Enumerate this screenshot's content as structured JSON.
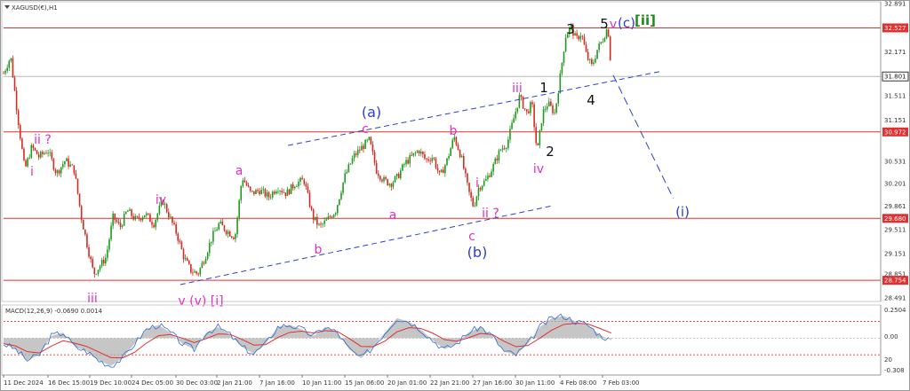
{
  "header": {
    "title": "XAGUSD(€),H1",
    "macd_title": "MACD(12,26,9) -0.0690 0.0014"
  },
  "colors": {
    "up": "#1f9a1f",
    "down": "#d42a1f",
    "hline": "#e03030",
    "channel": "#2b3fd0",
    "magenta": "#e030c0",
    "black": "#111111",
    "green": "#1f8a1f",
    "macd_line": "#2a6ad8",
    "signal": "#e03030",
    "hist": "#b3b3b3",
    "grid_text": "#333333"
  },
  "price_axis": {
    "ticks": [
      "32.891",
      "32.527",
      "32.171",
      "31.801",
      "31.511",
      "31.151",
      "30.972",
      "30.531",
      "30.201",
      "29.861",
      "29.680",
      "29.511",
      "29.151",
      "28.851",
      "28.754",
      "28.491"
    ]
  },
  "macd_axis": {
    "ticks": [
      "0.2504",
      "0.00",
      "20",
      "-0.308"
    ]
  },
  "time_axis": {
    "ticks": [
      "11 Dec 2024",
      "16 Dec 15:00",
      "19 Dec 10:00",
      "24 Dec 05:00",
      "30 Dec 03:00",
      "2 Jan 21:00",
      "7 Jan 16:00",
      "10 Jan 11:00",
      "15 Jan 06:00",
      "20 Jan 01:00",
      "22 Jan 21:00",
      "27 Jan 16:00",
      "30 Jan 11:00",
      "4 Feb 08:00",
      "7 Feb 03:00"
    ]
  },
  "wave_labels": [
    {
      "text": "ii ?",
      "color": "magenta"
    },
    {
      "text": "i",
      "color": "magenta"
    },
    {
      "text": "iii",
      "color": "magenta"
    },
    {
      "text": "iv",
      "color": "magenta"
    },
    {
      "text": "v (v) [i]",
      "color": "magenta"
    },
    {
      "text": "a",
      "color": "magenta"
    },
    {
      "text": "b",
      "color": "magenta"
    },
    {
      "text": "(a)",
      "color": "blue"
    },
    {
      "text": "c",
      "color": "magenta"
    },
    {
      "text": "a",
      "color": "magenta"
    },
    {
      "text": "b",
      "color": "magenta"
    },
    {
      "text": "i",
      "color": "magenta"
    },
    {
      "text": "ii ?",
      "color": "magenta"
    },
    {
      "text": "c",
      "color": "magenta"
    },
    {
      "text": "(b)",
      "color": "blue"
    },
    {
      "text": "iii",
      "color": "magenta"
    },
    {
      "text": "iv",
      "color": "magenta"
    },
    {
      "text": "1",
      "color": "black"
    },
    {
      "text": "2",
      "color": "black"
    },
    {
      "text": "3",
      "color": "black"
    },
    {
      "text": "4",
      "color": "black"
    },
    {
      "text": "5",
      "color": "black"
    },
    {
      "text": "v",
      "color": "magenta"
    },
    {
      "text": "(c)",
      "color": "blue"
    },
    {
      "text": "[ii]",
      "color": "green"
    },
    {
      "text": "(i)",
      "color": "blue"
    }
  ],
  "chart_data": {
    "type": "candlestick",
    "symbol": "XAGUSD(€)",
    "timeframe": "H1",
    "ylim": [
      28.491,
      32.891
    ],
    "horizontal_levels": [
      32.527,
      31.801,
      30.972,
      29.68,
      28.754
    ],
    "current_price": 31.801,
    "close_path": [
      [
        0,
        31.85
      ],
      [
        8,
        32.1
      ],
      [
        16,
        31.2
      ],
      [
        24,
        30.4
      ],
      [
        32,
        30.75
      ],
      [
        40,
        30.6
      ],
      [
        50,
        30.7
      ],
      [
        60,
        30.35
      ],
      [
        70,
        30.55
      ],
      [
        80,
        30.4
      ],
      [
        88,
        29.7
      ],
      [
        96,
        29.2
      ],
      [
        102,
        28.85
      ],
      [
        108,
        28.95
      ],
      [
        116,
        29.1
      ],
      [
        124,
        29.7
      ],
      [
        132,
        29.55
      ],
      [
        140,
        29.8
      ],
      [
        150,
        29.65
      ],
      [
        160,
        29.75
      ],
      [
        170,
        29.6
      ],
      [
        180,
        29.95
      ],
      [
        188,
        29.7
      ],
      [
        196,
        29.45
      ],
      [
        204,
        29.1
      ],
      [
        212,
        28.9
      ],
      [
        220,
        28.85
      ],
      [
        228,
        29.1
      ],
      [
        236,
        29.4
      ],
      [
        244,
        29.6
      ],
      [
        252,
        29.5
      ],
      [
        262,
        29.4
      ],
      [
        270,
        30.3
      ],
      [
        280,
        30.05
      ],
      [
        290,
        30.1
      ],
      [
        300,
        30.0
      ],
      [
        310,
        30.15
      ],
      [
        320,
        30.05
      ],
      [
        330,
        30.2
      ],
      [
        340,
        30.25
      ],
      [
        350,
        29.7
      ],
      [
        358,
        29.55
      ],
      [
        366,
        29.65
      ],
      [
        376,
        29.8
      ],
      [
        386,
        30.3
      ],
      [
        396,
        30.6
      ],
      [
        406,
        30.75
      ],
      [
        414,
        30.85
      ],
      [
        422,
        30.4
      ],
      [
        430,
        30.25
      ],
      [
        438,
        30.2
      ],
      [
        446,
        30.3
      ],
      [
        454,
        30.5
      ],
      [
        462,
        30.6
      ],
      [
        470,
        30.7
      ],
      [
        478,
        30.55
      ],
      [
        486,
        30.6
      ],
      [
        494,
        30.3
      ],
      [
        502,
        30.55
      ],
      [
        510,
        30.9
      ],
      [
        518,
        30.6
      ],
      [
        526,
        30.1
      ],
      [
        532,
        29.85
      ],
      [
        538,
        30.15
      ],
      [
        546,
        30.25
      ],
      [
        554,
        30.45
      ],
      [
        562,
        30.7
      ],
      [
        570,
        30.8
      ],
      [
        578,
        31.2
      ],
      [
        584,
        31.5
      ],
      [
        592,
        31.25
      ],
      [
        598,
        31.4
      ],
      [
        604,
        30.65
      ],
      [
        610,
        31.25
      ],
      [
        616,
        31.4
      ],
      [
        624,
        31.25
      ],
      [
        630,
        31.8
      ],
      [
        636,
        32.4
      ],
      [
        642,
        32.55
      ],
      [
        648,
        32.35
      ],
      [
        654,
        32.45
      ],
      [
        660,
        32.1
      ],
      [
        666,
        31.95
      ],
      [
        672,
        32.2
      ],
      [
        678,
        32.35
      ],
      [
        684,
        32.55
      ],
      [
        688,
        31.85
      ]
    ],
    "channel_lines": [
      {
        "from": [
          200,
          28.69
        ],
        "to": [
          622,
          29.87
        ]
      },
      {
        "from": [
          322,
          30.77
        ],
        "to": [
          745,
          31.88
        ]
      }
    ],
    "projection": {
      "path": [
        [
          690,
          31.82
        ],
        [
          758,
          29.98
        ]
      ],
      "label": "(i)"
    },
    "macd": {
      "ylim": [
        -0.308,
        0.2504
      ],
      "levels": [
        0.15,
        0.0,
        -0.15
      ],
      "values": [
        -0.05,
        -0.1,
        -0.2,
        -0.15,
        0.02,
        0.05,
        -0.08,
        -0.12,
        -0.2,
        -0.25,
        -0.18,
        -0.05,
        0.08,
        0.12,
        0.05,
        -0.05,
        -0.1,
        0.05,
        0.1,
        0.03,
        -0.08,
        -0.14,
        -0.05,
        0.1,
        0.12,
        0.08,
        0.02,
        0.1,
        0.05,
        -0.1,
        -0.18,
        -0.08,
        0.05,
        0.18,
        0.15,
        0.08,
        -0.02,
        -0.1,
        -0.05,
        0.05,
        0.1,
        0.02,
        -0.12,
        -0.15,
        -0.05,
        0.1,
        0.18,
        0.2,
        0.15,
        0.12,
        0.03,
        -0.02
      ]
    }
  }
}
